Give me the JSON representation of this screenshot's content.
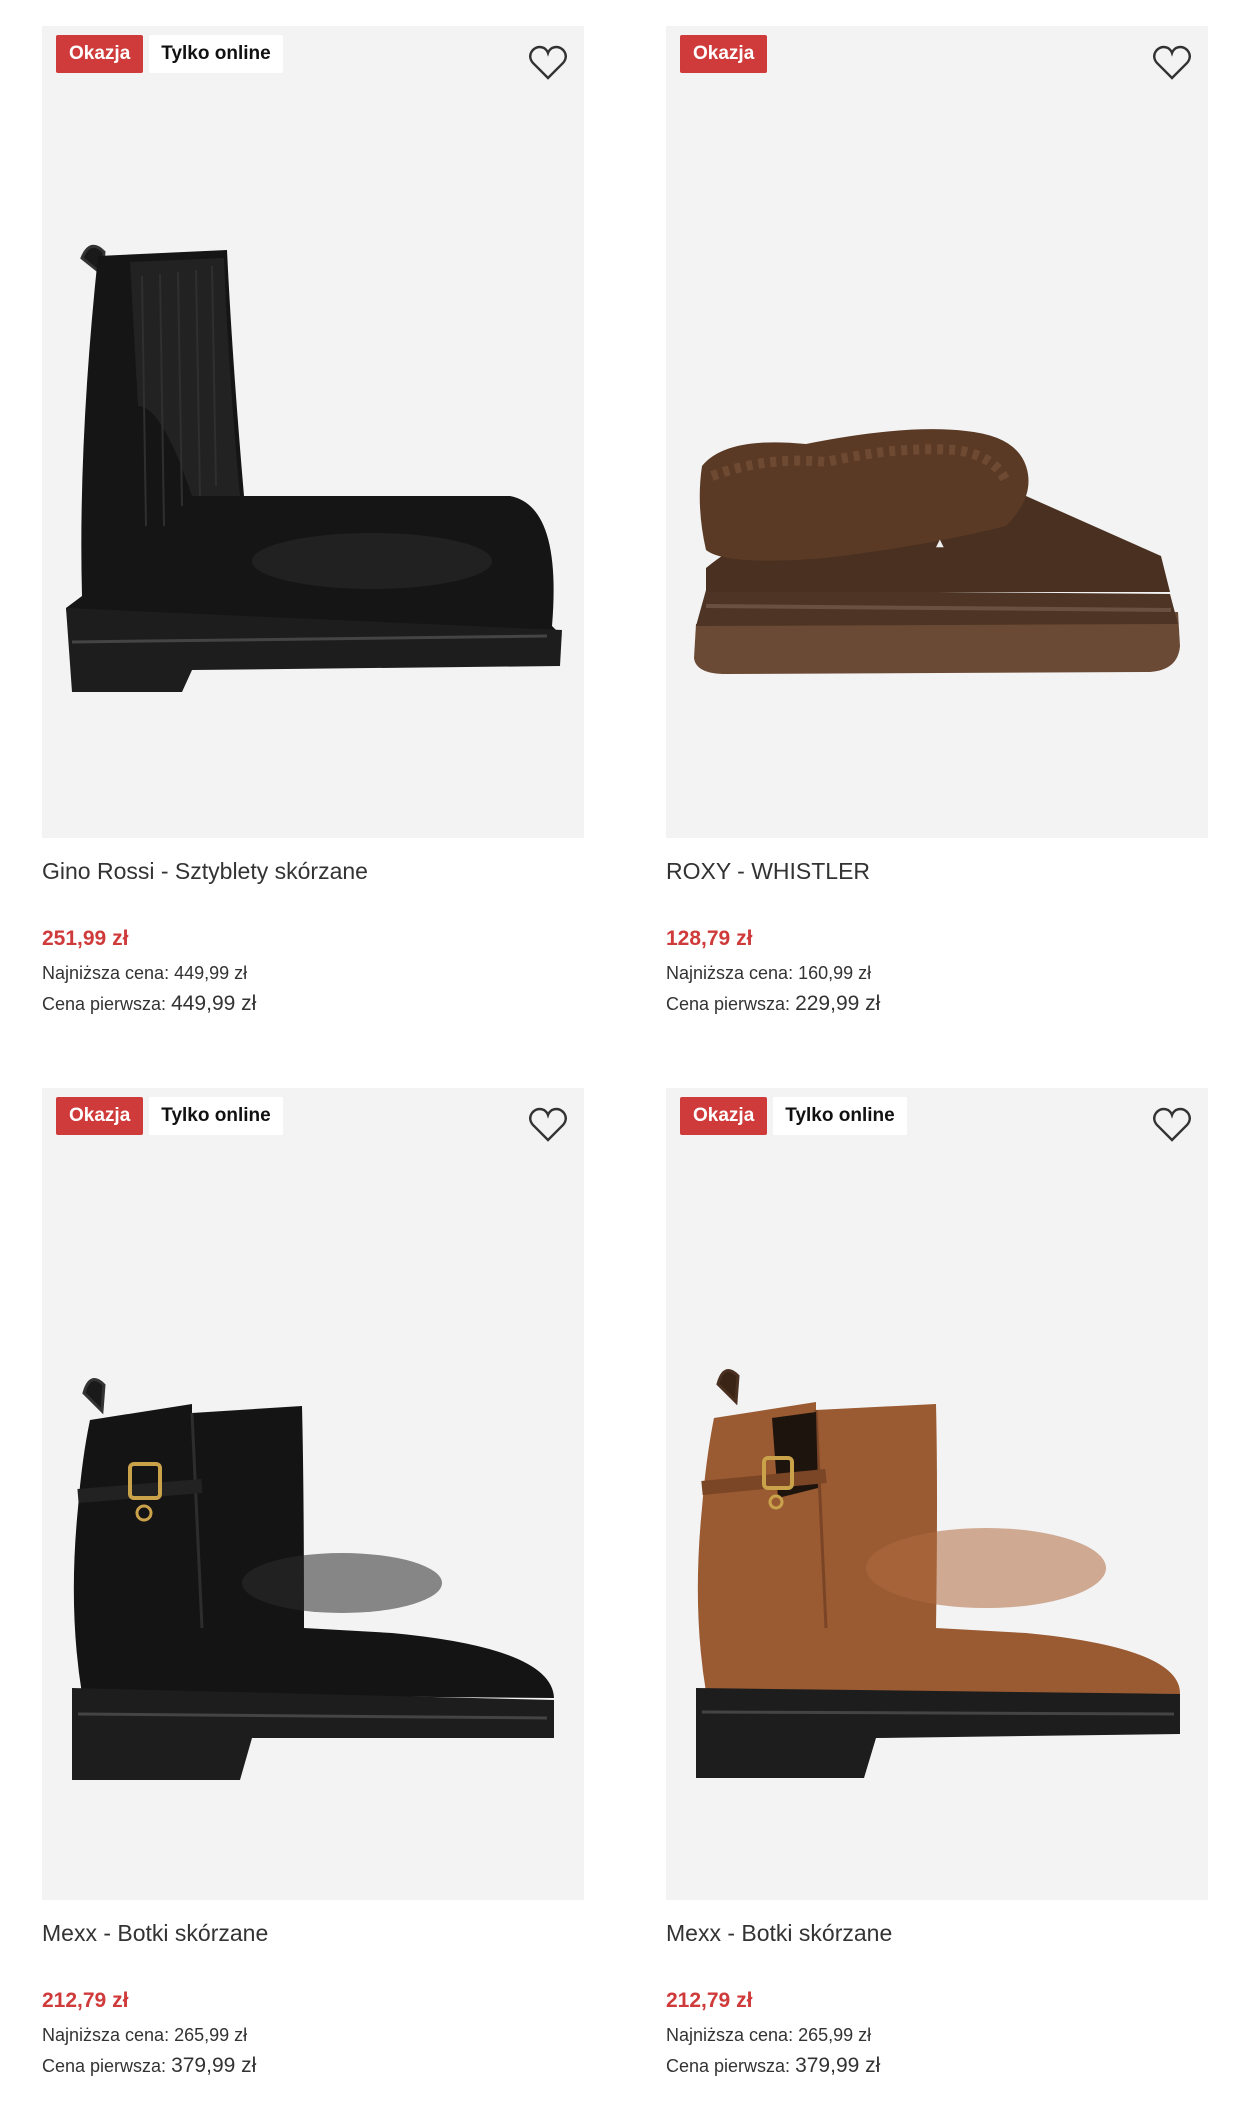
{
  "products": [
    {
      "badges": [
        "Okazja",
        "Tylko online"
      ],
      "name": "Gino Rossi - Sztyblety skórzane",
      "price": "251,99 zł",
      "lowest_label": "Najniższa cena:",
      "lowest_value": "449,99 zł",
      "first_label": "Cena pierwsza:",
      "first_value": "449,99 zł",
      "image": "black-chelsea-boot"
    },
    {
      "badges": [
        "Okazja"
      ],
      "name": "ROXY - WHISTLER",
      "price": "128,79 zł",
      "lowest_label": "Najniższa cena:",
      "lowest_value": "160,99 zł",
      "first_label": "Cena pierwsza:",
      "first_value": "229,99 zł",
      "image": "brown-fur-slipper"
    },
    {
      "badges": [
        "Okazja",
        "Tylko online"
      ],
      "name": "Mexx - Botki skórzane",
      "price": "212,79 zł",
      "lowest_label": "Najniższa cena:",
      "lowest_value": "265,99 zł",
      "first_label": "Cena pierwsza:",
      "first_value": "379,99 zł",
      "image": "black-ankle-boot-buckle"
    },
    {
      "badges": [
        "Okazja",
        "Tylko online"
      ],
      "name": "Mexx - Botki skórzane",
      "price": "212,79 zł",
      "lowest_label": "Najniższa cena:",
      "lowest_value": "265,99 zł",
      "first_label": "Cena pierwsza:",
      "first_value": "379,99 zł",
      "image": "brown-ankle-boot-buckle"
    }
  ],
  "colors": {
    "sale_red": "#cf3a3a",
    "image_bg": "#f3f3f3"
  },
  "icons": {
    "wishlist": "heart-outline-icon"
  }
}
